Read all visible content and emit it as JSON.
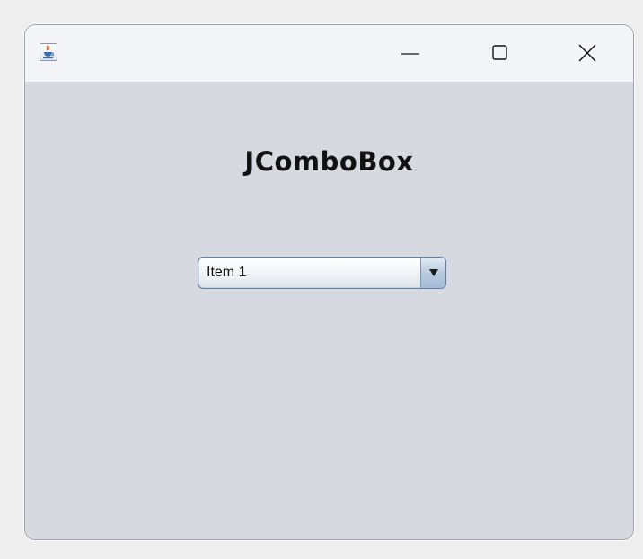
{
  "window": {
    "icon": "java-coffee-cup-icon",
    "controls": {
      "minimize_icon": "minimize-icon",
      "maximize_icon": "maximize-icon",
      "close_icon": "close-icon"
    }
  },
  "content": {
    "heading": "JComboBox",
    "combo": {
      "selected": "Item 1",
      "arrow_icon": "triangle-down-icon"
    }
  },
  "colors": {
    "titlebar_bg": "#f3f5f9",
    "content_bg": "#d6d9df",
    "combo_border": "#5f7ea3",
    "combo_button_bg": "#b9cbe0"
  }
}
